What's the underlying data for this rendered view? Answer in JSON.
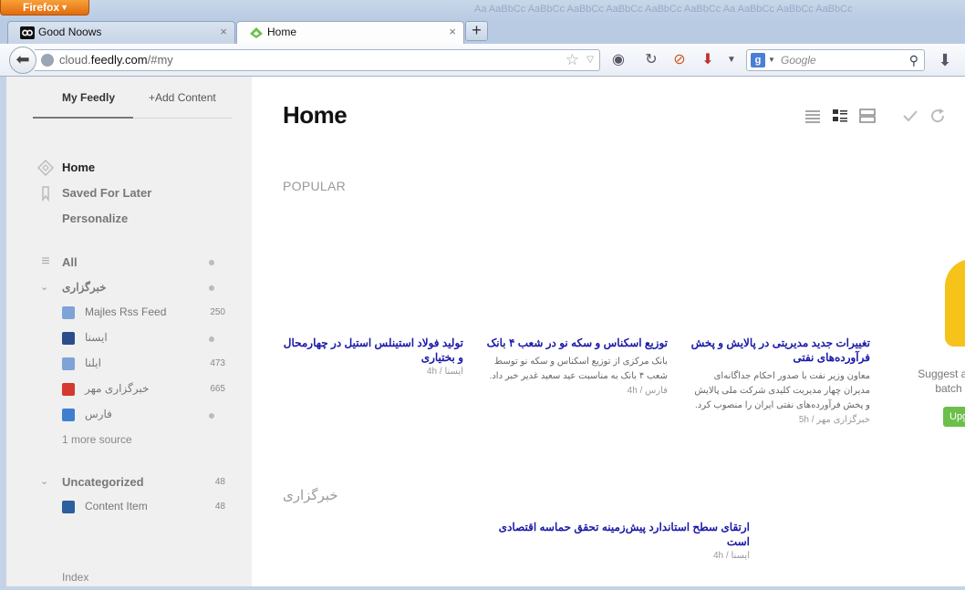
{
  "browser": {
    "app_button": "Firefox",
    "tabs": [
      {
        "title": "Good Noows"
      },
      {
        "title": "Home"
      }
    ],
    "new_tab": "+",
    "url": {
      "scheme_host_prefix": "cloud.",
      "host": "feedly.com",
      "path": "/#my"
    },
    "search_placeholder": "Google",
    "ghost_toolbar": "Aa  AaBbCc  AaBbCc  AaBbCc  AaBbCc  AaBbCc  AaBbCc  Aa  AaBbCc  AaBbCc  AaBbCc"
  },
  "sidebar": {
    "tabs": [
      "My Feedly",
      "+Add Content"
    ],
    "nav": [
      {
        "label": "Home",
        "icon": "home-icon"
      },
      {
        "label": "Saved For Later",
        "icon": "bookmark-icon"
      },
      {
        "label": "Personalize"
      }
    ],
    "all_label": "All",
    "group1": {
      "name": "خبرگزاری",
      "feeds": [
        {
          "name": "Majles Rss Feed",
          "count": "250"
        },
        {
          "name": "ایسنا",
          "count": ""
        },
        {
          "name": "ایلنا",
          "count": "473"
        },
        {
          "name": "خبرگزاری مهر",
          "count": "665"
        },
        {
          "name": "فارس",
          "count": ""
        }
      ],
      "more": "1 more source"
    },
    "group2": {
      "name": "Uncategorized",
      "count": "48",
      "feeds": [
        {
          "name": "Content Item",
          "count": "48"
        }
      ]
    },
    "footer": "Index"
  },
  "main": {
    "title": "Home",
    "popular_label": "POPULAR",
    "cards": [
      {
        "title": "تولید فولاد استینلس استیل در چهارمحال و بختیاری",
        "summary": "",
        "meta": "ایسنا / 4h"
      },
      {
        "title": "توزیع اسکناس و سکه نو در شعب ۴ بانک",
        "summary": "بانک مرکزی از توزیع اسکناس و سکه نو توسط شعب ۴ بانک به مناسبت عید سعید غدیر خبر داد.",
        "meta": "فارس / 4h"
      },
      {
        "title": "تغییرات جدید مدیریتی در پالایش و پخش فرآورده‌های نفتی",
        "summary": "معاون وزیر نفت با صدور احکام جداگانه‌ای مدیران چهار مدیریت کلیدی شرکت ملی پالایش و پخش فرآورده‌های نفتی ایران را منصوب کرد.",
        "meta": "خبرگزاری مهر / 5h"
      }
    ],
    "upsell_text": "Suggest and batch",
    "upsell_button": "Upg",
    "section2_label": "خبرگزاری",
    "section2_card": {
      "title": "ارتقای سطح استاندارد پیش‌زمینه تحقق حماسه اقتصادی است",
      "meta": "ایسنا / 4h"
    }
  }
}
